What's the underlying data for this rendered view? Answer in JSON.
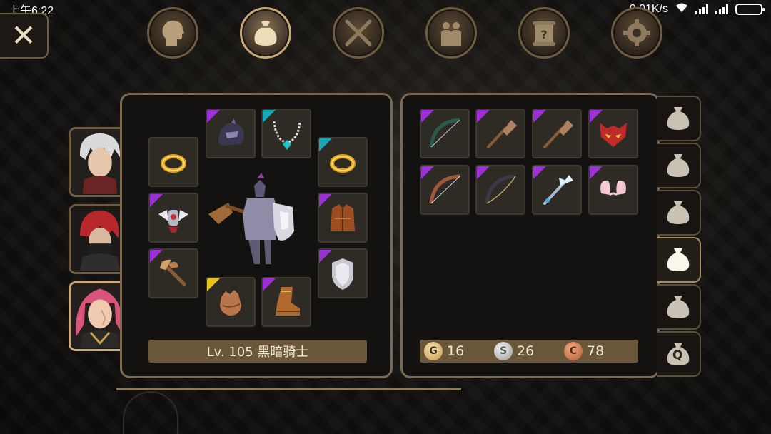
{
  "status_bar": {
    "time": "上午6:22",
    "net_speed": "0.01K/s"
  },
  "top_menu": [
    {
      "name": "hero",
      "icon": "head-silhouette-icon",
      "active": false
    },
    {
      "name": "bag",
      "icon": "bag-icon",
      "active": true
    },
    {
      "name": "skills",
      "icon": "crossed-swords-icon",
      "active": false
    },
    {
      "name": "party",
      "icon": "people-icon",
      "active": false
    },
    {
      "name": "quest",
      "icon": "scroll-icon",
      "active": false
    },
    {
      "name": "settings",
      "icon": "gear-icon",
      "active": false
    }
  ],
  "heroes": [
    {
      "name": "white-hair-warrior",
      "active": false
    },
    {
      "name": "red-hair-assassin",
      "active": false
    },
    {
      "name": "pink-hair-knight",
      "active": true
    }
  ],
  "equipment": [
    {
      "slot": "ring-left",
      "item": "gold-ring",
      "rarity": "none"
    },
    {
      "slot": "helmet",
      "item": "dark-helmet",
      "rarity": "epic"
    },
    {
      "slot": "necklace",
      "item": "gem-necklace",
      "rarity": "rare"
    },
    {
      "slot": "ring-right",
      "item": "gold-ring",
      "rarity": "rare"
    },
    {
      "slot": "shoulders",
      "item": "winged-pauldrons",
      "rarity": "epic"
    },
    {
      "slot": "armor",
      "item": "leather-vest",
      "rarity": "epic"
    },
    {
      "slot": "weapon",
      "item": "battle-axe",
      "rarity": "epic"
    },
    {
      "slot": "shield",
      "item": "silver-shield",
      "rarity": "epic"
    },
    {
      "slot": "gloves",
      "item": "leather-gloves",
      "rarity": "legend"
    },
    {
      "slot": "boots",
      "item": "leather-boots",
      "rarity": "epic"
    }
  ],
  "character": {
    "level_label": "Lv. 105 黑暗骑士"
  },
  "inventory": [
    {
      "item": "dark-bow",
      "rarity": "epic"
    },
    {
      "item": "wooden-club",
      "rarity": "epic"
    },
    {
      "item": "wooden-club",
      "rarity": "epic"
    },
    {
      "item": "demon-mask",
      "rarity": "epic"
    },
    {
      "item": "bronze-bow",
      "rarity": "epic"
    },
    {
      "item": "shadow-bow",
      "rarity": "epic"
    },
    {
      "item": "crystal-staff",
      "rarity": "epic"
    },
    {
      "item": "bunny-ears",
      "rarity": "epic"
    }
  ],
  "currency": {
    "gold_symbol": "G",
    "gold": "16",
    "silver_symbol": "S",
    "silver": "26",
    "copper_symbol": "C",
    "copper": "78"
  },
  "bag_tabs": [
    {
      "name": "bag-1",
      "active": false
    },
    {
      "name": "bag-2",
      "active": false
    },
    {
      "name": "bag-3",
      "active": false
    },
    {
      "name": "bag-4",
      "active": true
    },
    {
      "name": "bag-5",
      "active": false
    },
    {
      "name": "quest-bag",
      "label": "Q",
      "active": false
    }
  ],
  "colors": {
    "rarity_epic": "#9b30d6",
    "rarity_rare": "#19a8b8",
    "rarity_legend": "#e6c21a",
    "frame": "#7a6a52",
    "label_bar": "#6a5638"
  }
}
